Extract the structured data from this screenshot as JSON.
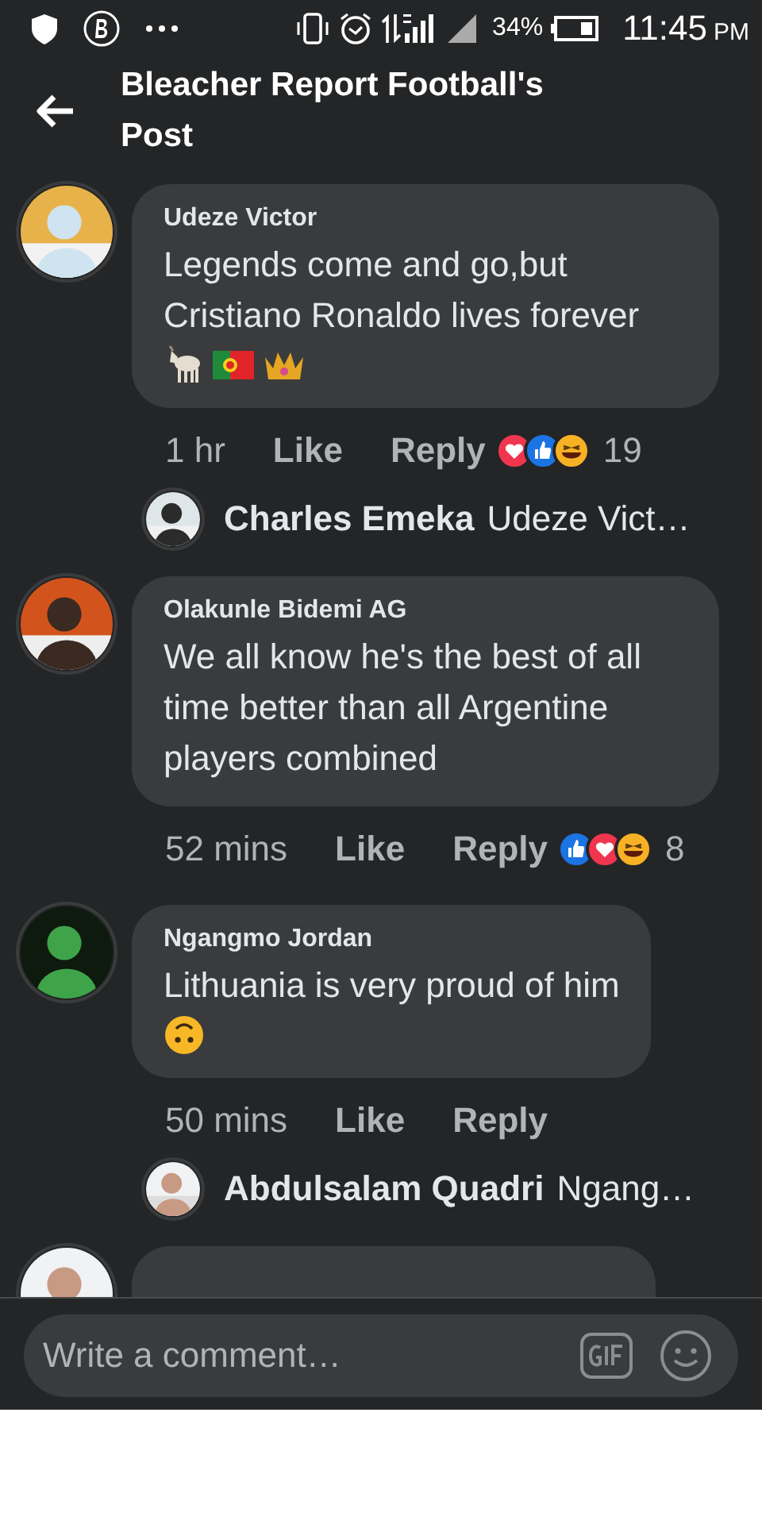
{
  "status_bar": {
    "battery_text": "34%",
    "time": "11:45",
    "meridiem": "PM"
  },
  "header": {
    "title": "Bleacher Report Football's Post"
  },
  "comments": [
    {
      "kind": "full",
      "author": "Udeze Victor",
      "text": "Legends come and go,but Cristiano Ronaldo lives forever",
      "trailing_icons": [
        {
          "kind": "goat"
        },
        {
          "kind": "flag"
        },
        {
          "kind": "crown"
        }
      ],
      "time": "1 hr",
      "like": "Like",
      "reply": "Reply",
      "reactions": [
        {
          "kind": "love"
        },
        {
          "kind": "like"
        },
        {
          "kind": "haha"
        }
      ],
      "reaction_count": "19",
      "reply_preview": {
        "author": "Charles Emeka",
        "text": "Udeze Vict…"
      }
    },
    {
      "kind": "full",
      "author": "Olakunle Bidemi AG",
      "text": "We all know he's the best of all time better than all Argentine players combined",
      "time": "52 mins",
      "like": "Like",
      "reply": "Reply",
      "reactions": [
        {
          "kind": "like"
        },
        {
          "kind": "love"
        },
        {
          "kind": "haha"
        }
      ],
      "reaction_count": "8"
    },
    {
      "kind": "full",
      "author": "Ngangmo Jordan",
      "text": "Lithuania is very proud of him",
      "trailing_icons": [
        {
          "kind": "upside"
        }
      ],
      "time": "50 mins",
      "like": "Like",
      "reply": "Reply",
      "reply_preview": {
        "author": "Abdulsalam Quadri",
        "text": "Ngang…"
      }
    },
    {
      "kind": "partial"
    }
  ],
  "composer": {
    "placeholder": "Write a comment…"
  }
}
